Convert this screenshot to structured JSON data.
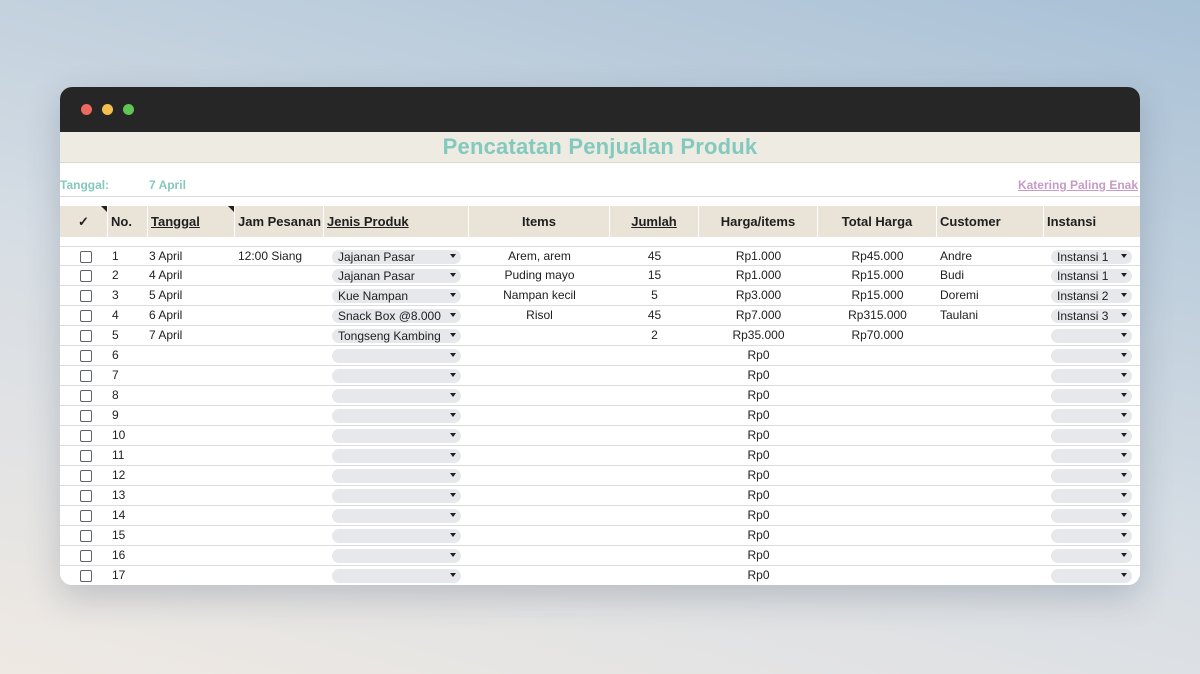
{
  "sheet": {
    "title": "Pencatatan Penjualan Produk",
    "date_label": "Tanggal:",
    "date_value": "7 April",
    "brand": "Katering Paling Enak"
  },
  "colors": {
    "title_accent": "#84c9bd",
    "brand_link": "#c79bc7",
    "header_bg": "#e9e3d8",
    "title_band_bg": "#eeebe3",
    "titlebar": "#262626",
    "chip_bg": "#e6e8eb"
  },
  "icons": {
    "header_check": "check-icon",
    "dropdown": "caret-down-icon",
    "window_controls": [
      "close-dot-icon",
      "minimize-dot-icon",
      "maximize-dot-icon"
    ]
  },
  "headers": {
    "check": "✓",
    "no": "No.",
    "tanggal": "Tanggal",
    "jam": "Jam Pesanan",
    "jenis": "Jenis Produk",
    "items": "Items",
    "jumlah": "Jumlah",
    "harga": "Harga/items",
    "total": "Total Harga",
    "customer": "Customer",
    "instansi": "Instansi"
  },
  "rows": [
    {
      "no": "1",
      "tanggal": "3 April",
      "jam": "12:00 Siang",
      "jenis": "Jajanan Pasar",
      "items": "Arem, arem",
      "jumlah": "45",
      "harga": "Rp1.000",
      "total": "Rp45.000",
      "customer": "Andre",
      "instansi": "Instansi 1"
    },
    {
      "no": "2",
      "tanggal": "4 April",
      "jam": "",
      "jenis": "Jajanan Pasar",
      "items": "Puding mayo",
      "jumlah": "15",
      "harga": "Rp1.000",
      "total": "Rp15.000",
      "customer": "Budi",
      "instansi": "Instansi 1"
    },
    {
      "no": "3",
      "tanggal": "5 April",
      "jam": "",
      "jenis": "Kue Nampan",
      "items": "Nampan kecil",
      "jumlah": "5",
      "harga": "Rp3.000",
      "total": "Rp15.000",
      "customer": "Doremi",
      "instansi": "Instansi 2"
    },
    {
      "no": "4",
      "tanggal": "6 April",
      "jam": "",
      "jenis": "Snack Box @8.000",
      "items": "Risol",
      "jumlah": "45",
      "harga": "Rp7.000",
      "total": "Rp315.000",
      "customer": "Taulani",
      "instansi": "Instansi 3"
    },
    {
      "no": "5",
      "tanggal": "7 April",
      "jam": "",
      "jenis": "Tongseng Kambing",
      "items": "",
      "jumlah": "2",
      "harga": "Rp35.000",
      "total": "Rp70.000",
      "customer": "",
      "instansi": ""
    },
    {
      "no": "6",
      "tanggal": "",
      "jam": "",
      "jenis": "",
      "items": "",
      "jumlah": "",
      "harga": "Rp0",
      "total": "",
      "customer": "",
      "instansi": ""
    },
    {
      "no": "7",
      "tanggal": "",
      "jam": "",
      "jenis": "",
      "items": "",
      "jumlah": "",
      "harga": "Rp0",
      "total": "",
      "customer": "",
      "instansi": ""
    },
    {
      "no": "8",
      "tanggal": "",
      "jam": "",
      "jenis": "",
      "items": "",
      "jumlah": "",
      "harga": "Rp0",
      "total": "",
      "customer": "",
      "instansi": ""
    },
    {
      "no": "9",
      "tanggal": "",
      "jam": "",
      "jenis": "",
      "items": "",
      "jumlah": "",
      "harga": "Rp0",
      "total": "",
      "customer": "",
      "instansi": ""
    },
    {
      "no": "10",
      "tanggal": "",
      "jam": "",
      "jenis": "",
      "items": "",
      "jumlah": "",
      "harga": "Rp0",
      "total": "",
      "customer": "",
      "instansi": ""
    },
    {
      "no": "11",
      "tanggal": "",
      "jam": "",
      "jenis": "",
      "items": "",
      "jumlah": "",
      "harga": "Rp0",
      "total": "",
      "customer": "",
      "instansi": ""
    },
    {
      "no": "12",
      "tanggal": "",
      "jam": "",
      "jenis": "",
      "items": "",
      "jumlah": "",
      "harga": "Rp0",
      "total": "",
      "customer": "",
      "instansi": ""
    },
    {
      "no": "13",
      "tanggal": "",
      "jam": "",
      "jenis": "",
      "items": "",
      "jumlah": "",
      "harga": "Rp0",
      "total": "",
      "customer": "",
      "instansi": ""
    },
    {
      "no": "14",
      "tanggal": "",
      "jam": "",
      "jenis": "",
      "items": "",
      "jumlah": "",
      "harga": "Rp0",
      "total": "",
      "customer": "",
      "instansi": ""
    },
    {
      "no": "15",
      "tanggal": "",
      "jam": "",
      "jenis": "",
      "items": "",
      "jumlah": "",
      "harga": "Rp0",
      "total": "",
      "customer": "",
      "instansi": ""
    },
    {
      "no": "16",
      "tanggal": "",
      "jam": "",
      "jenis": "",
      "items": "",
      "jumlah": "",
      "harga": "Rp0",
      "total": "",
      "customer": "",
      "instansi": ""
    },
    {
      "no": "17",
      "tanggal": "",
      "jam": "",
      "jenis": "",
      "items": "",
      "jumlah": "",
      "harga": "Rp0",
      "total": "",
      "customer": "",
      "instansi": ""
    }
  ]
}
